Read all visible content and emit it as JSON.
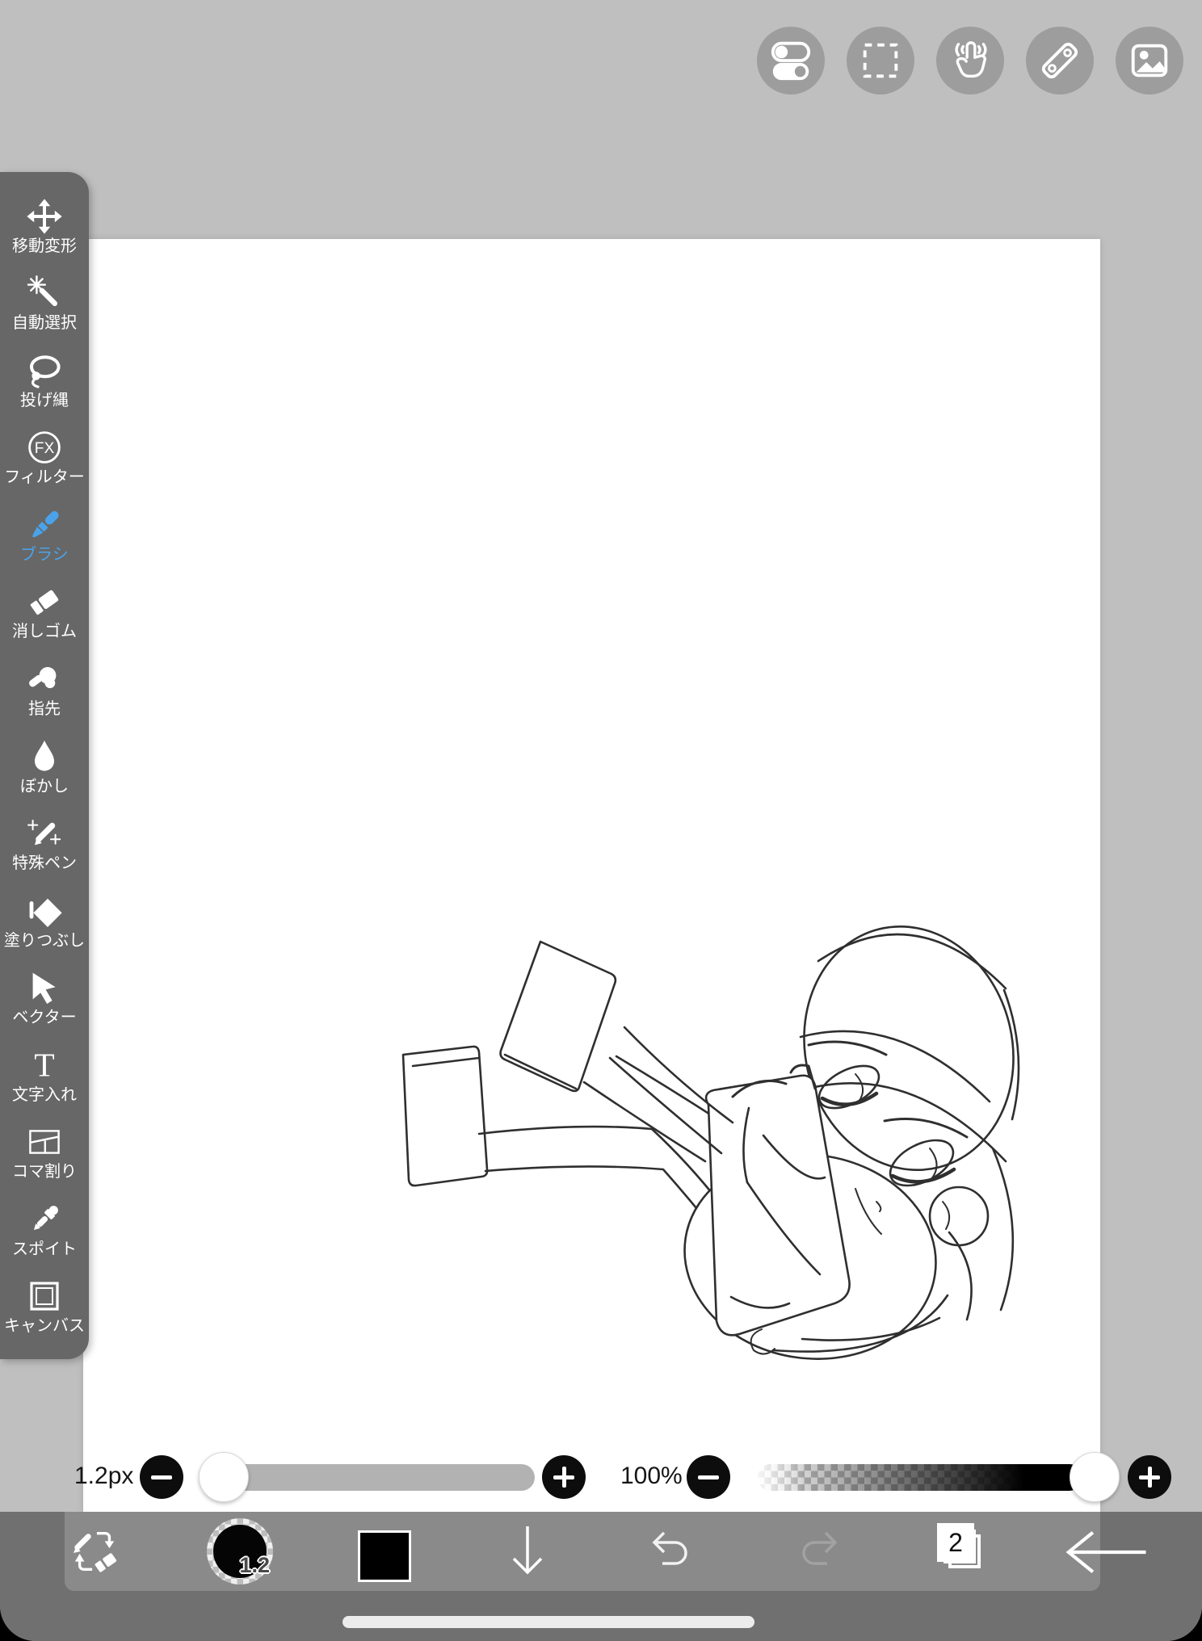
{
  "colors": {
    "accent_blue": "#4aa3ea",
    "canvas_white": "#ffffff",
    "ink": "#2f2f2f"
  },
  "top_toolbar": {
    "buttons": [
      {
        "icon": "toggles-settings-icon"
      },
      {
        "icon": "selection-marquee-icon"
      },
      {
        "icon": "touch-gesture-icon"
      },
      {
        "icon": "ruler-icon"
      },
      {
        "icon": "image-reference-icon"
      }
    ]
  },
  "sidebar": {
    "fx_text": "FX",
    "text_tool_glyph": "T",
    "items": [
      {
        "label": "移動変形",
        "icon": "move-transform-icon",
        "active": false
      },
      {
        "label": "自動選択",
        "icon": "magic-wand-icon",
        "active": false
      },
      {
        "label": "投げ縄",
        "icon": "lasso-icon",
        "active": false
      },
      {
        "label": "フィルター",
        "icon": "fx-filter-icon",
        "active": false
      },
      {
        "label": "ブラシ",
        "icon": "brush-icon",
        "active": true
      },
      {
        "label": "消しゴム",
        "icon": "eraser-icon",
        "active": false
      },
      {
        "label": "指先",
        "icon": "fingertip-icon",
        "active": false
      },
      {
        "label": "ぼかし",
        "icon": "blur-drop-icon",
        "active": false
      },
      {
        "label": "特殊ペン",
        "icon": "special-pen-icon",
        "active": false
      },
      {
        "label": "塗りつぶし",
        "icon": "fill-bucket-icon",
        "active": false
      },
      {
        "label": "ベクター",
        "icon": "vector-cursor-icon",
        "active": false
      },
      {
        "label": "文字入れ",
        "icon": "text-tool-icon",
        "active": false
      },
      {
        "label": "コマ割り",
        "icon": "panel-divide-icon",
        "active": false
      },
      {
        "label": "スポイト",
        "icon": "eyedropper-icon",
        "active": false
      },
      {
        "label": "キャンバス",
        "icon": "canvas-tool-icon",
        "active": false
      }
    ]
  },
  "sliders": {
    "brush_size": {
      "label": "1.2px",
      "value_percent": 2
    },
    "opacity": {
      "label": "100%",
      "value_percent": 100
    }
  },
  "bottom_toolbar": {
    "brush_size_badge": "1.2",
    "layers_count": "2",
    "icons": [
      "brush-eraser-swap-icon",
      "brush-size-preview",
      "color-swatch",
      "down-arrow-icon",
      "undo-icon",
      "redo-icon",
      "layers-icon",
      "back-arrow-icon"
    ]
  },
  "canvas": {
    "sketch_description": "rough pencil sketch of a chibi figure hugging a backpack, legs kicked up to the left"
  }
}
